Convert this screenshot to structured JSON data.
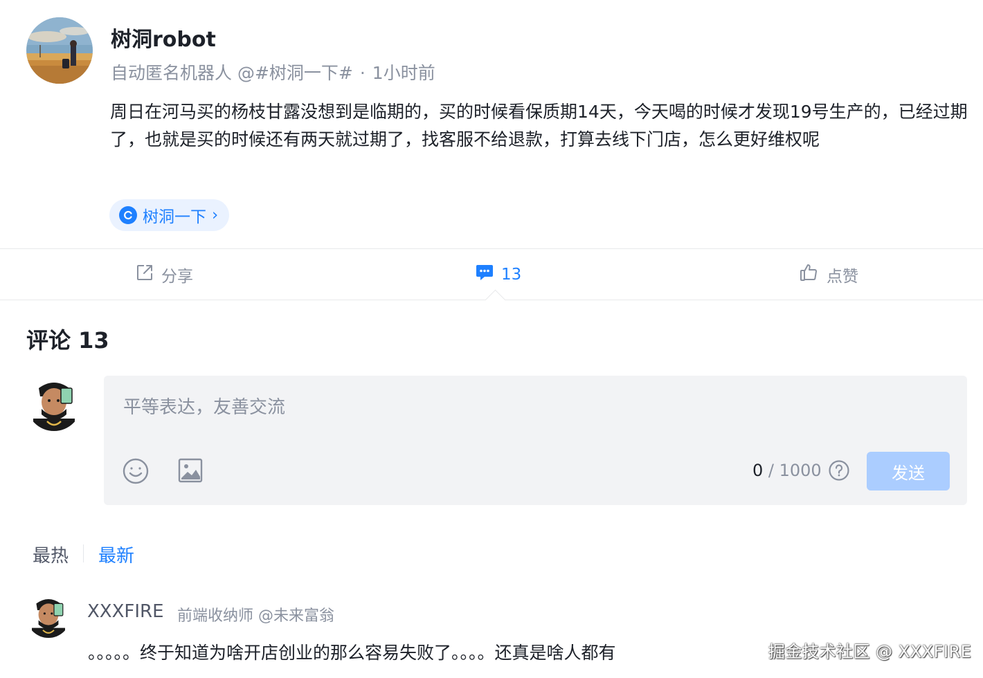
{
  "post": {
    "author_name": "树洞robot",
    "author_title": "自动匿名机器人 @#树洞一下#",
    "meta_separator": "·",
    "time": "1小时前",
    "content": "周日在河马买的杨枝甘露没想到是临期的，买的时候看保质期14天，今天喝的时候才发现19号生产的，已经过期了，也就是买的时候还有两天就过期了，找客服不给退款，打算去线下门店，怎么更好维权呢",
    "topic_label": "树洞一下",
    "topic_arrow": "›"
  },
  "actions": {
    "share_label": "分享",
    "comment_count": "13",
    "like_label": "点赞"
  },
  "comments": {
    "title": "评论 13",
    "input_placeholder": "平等表达，友善交流",
    "counter_current": "0",
    "counter_max": " / 1000",
    "send_label": "发送",
    "sort_hot": "最热",
    "sort_new": "最新",
    "items": [
      {
        "author": "XXXFIRE",
        "title": "前端收纳师 @未来富翁",
        "text": "。。。。。终于知道为啥开店创业的那么容易失败了。。。。还真是啥人都有"
      }
    ]
  },
  "watermark": "掘金技术社区 @ XXXFIRE",
  "colors": {
    "accent": "#1e80ff",
    "muted": "#8a919f",
    "send_disabled": "#abcdff"
  }
}
